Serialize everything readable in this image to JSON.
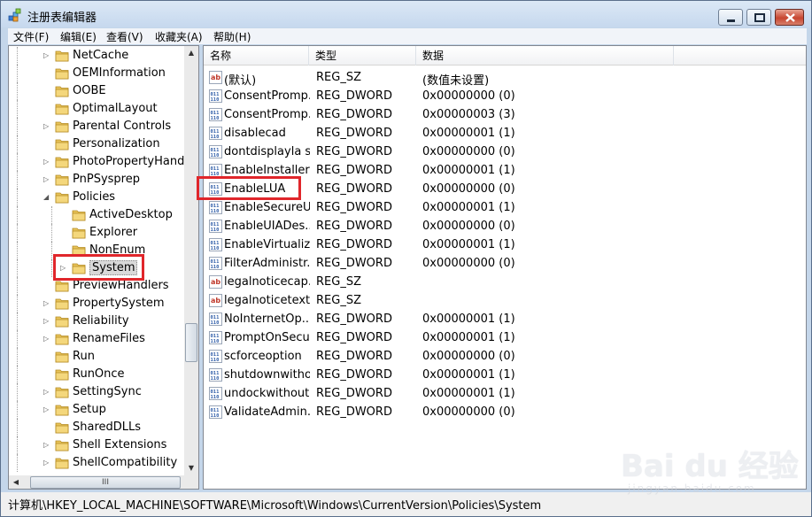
{
  "window": {
    "title": "注册表编辑器"
  },
  "menu": [
    "文件(F)",
    "编辑(E)",
    "查看(V)",
    "收藏夹(A)",
    "帮助(H)"
  ],
  "tree": {
    "items": [
      {
        "label": "NetCache",
        "level": 0,
        "expander": "collapsed"
      },
      {
        "label": "OEMInformation",
        "level": 0,
        "expander": "none"
      },
      {
        "label": "OOBE",
        "level": 0,
        "expander": "none"
      },
      {
        "label": "OptimalLayout",
        "level": 0,
        "expander": "none"
      },
      {
        "label": "Parental Controls",
        "level": 0,
        "expander": "collapsed"
      },
      {
        "label": "Personalization",
        "level": 0,
        "expander": "none"
      },
      {
        "label": "PhotoPropertyHandle",
        "level": 0,
        "expander": "collapsed"
      },
      {
        "label": "PnPSysprep",
        "level": 0,
        "expander": "collapsed"
      },
      {
        "label": "Policies",
        "level": 0,
        "expander": "expanded"
      },
      {
        "label": "ActiveDesktop",
        "level": 1,
        "expander": "none"
      },
      {
        "label": "Explorer",
        "level": 1,
        "expander": "none"
      },
      {
        "label": "NonEnum",
        "level": 1,
        "expander": "none"
      },
      {
        "label": "System",
        "level": 1,
        "expander": "collapsed",
        "selected": true
      },
      {
        "label": "PreviewHandlers",
        "level": 0,
        "expander": "none"
      },
      {
        "label": "PropertySystem",
        "level": 0,
        "expander": "collapsed"
      },
      {
        "label": "Reliability",
        "level": 0,
        "expander": "collapsed"
      },
      {
        "label": "RenameFiles",
        "level": 0,
        "expander": "collapsed"
      },
      {
        "label": "Run",
        "level": 0,
        "expander": "none"
      },
      {
        "label": "RunOnce",
        "level": 0,
        "expander": "none"
      },
      {
        "label": "SettingSync",
        "level": 0,
        "expander": "collapsed"
      },
      {
        "label": "Setup",
        "level": 0,
        "expander": "collapsed"
      },
      {
        "label": "SharedDLLs",
        "level": 0,
        "expander": "none"
      },
      {
        "label": "Shell Extensions",
        "level": 0,
        "expander": "collapsed"
      },
      {
        "label": "ShellCompatibility",
        "level": 0,
        "expander": "collapsed"
      }
    ],
    "hscroll_grip": "III"
  },
  "list": {
    "columns": [
      "名称",
      "类型",
      "数据"
    ],
    "rows": [
      {
        "icon": "string-value-icon",
        "name": "(默认)",
        "type": "REG_SZ",
        "data": "(数值未设置)"
      },
      {
        "icon": "dword-value-icon",
        "name": "ConsentPromp...",
        "type": "REG_DWORD",
        "data": "0x00000000 (0)"
      },
      {
        "icon": "dword-value-icon",
        "name": "ConsentPromp...",
        "type": "REG_DWORD",
        "data": "0x00000003 (3)"
      },
      {
        "icon": "dword-value-icon",
        "name": "disablecad",
        "type": "REG_DWORD",
        "data": "0x00000001 (1)"
      },
      {
        "icon": "dword-value-icon",
        "name": "dontdisplayla s...",
        "type": "REG_DWORD",
        "data": "0x00000000 (0)"
      },
      {
        "icon": "dword-value-icon",
        "name": "EnableInstaller...",
        "type": "REG_DWORD",
        "data": "0x00000001 (1)"
      },
      {
        "icon": "dword-value-icon",
        "name": "EnableLUA",
        "type": "REG_DWORD",
        "data": "0x00000000 (0)"
      },
      {
        "icon": "dword-value-icon",
        "name": "EnableSecureU...",
        "type": "REG_DWORD",
        "data": "0x00000001 (1)"
      },
      {
        "icon": "dword-value-icon",
        "name": "EnableUIADes...",
        "type": "REG_DWORD",
        "data": "0x00000000 (0)"
      },
      {
        "icon": "dword-value-icon",
        "name": "EnableVirtualiz...",
        "type": "REG_DWORD",
        "data": "0x00000001 (1)"
      },
      {
        "icon": "dword-value-icon",
        "name": "FilterAdministr...",
        "type": "REG_DWORD",
        "data": "0x00000000 (0)"
      },
      {
        "icon": "string-value-icon",
        "name": "legalnoticecap...",
        "type": "REG_SZ",
        "data": ""
      },
      {
        "icon": "string-value-icon",
        "name": "legalnoticetext",
        "type": "REG_SZ",
        "data": ""
      },
      {
        "icon": "dword-value-icon",
        "name": "NoInternetOp...",
        "type": "REG_DWORD",
        "data": "0x00000001 (1)"
      },
      {
        "icon": "dword-value-icon",
        "name": "PromptOnSecu...",
        "type": "REG_DWORD",
        "data": "0x00000001 (1)"
      },
      {
        "icon": "dword-value-icon",
        "name": "scforceoption",
        "type": "REG_DWORD",
        "data": "0x00000000 (0)"
      },
      {
        "icon": "dword-value-icon",
        "name": "shutdownwitho...",
        "type": "REG_DWORD",
        "data": "0x00000001 (1)"
      },
      {
        "icon": "dword-value-icon",
        "name": "undockwithout...",
        "type": "REG_DWORD",
        "data": "0x00000001 (1)"
      },
      {
        "icon": "dword-value-icon",
        "name": "ValidateAdmin...",
        "type": "REG_DWORD",
        "data": "0x00000000 (0)"
      }
    ]
  },
  "status": {
    "path": "计算机\\HKEY_LOCAL_MACHINE\\SOFTWARE\\Microsoft\\Windows\\CurrentVersion\\Policies\\System"
  },
  "watermark": {
    "main": "Bai du 经验",
    "sub": "jingyan.baidu.com"
  },
  "colors": {
    "highlight": "#e0262b",
    "folder": "#e8c35a",
    "accent_blue": "#2f5da8"
  }
}
